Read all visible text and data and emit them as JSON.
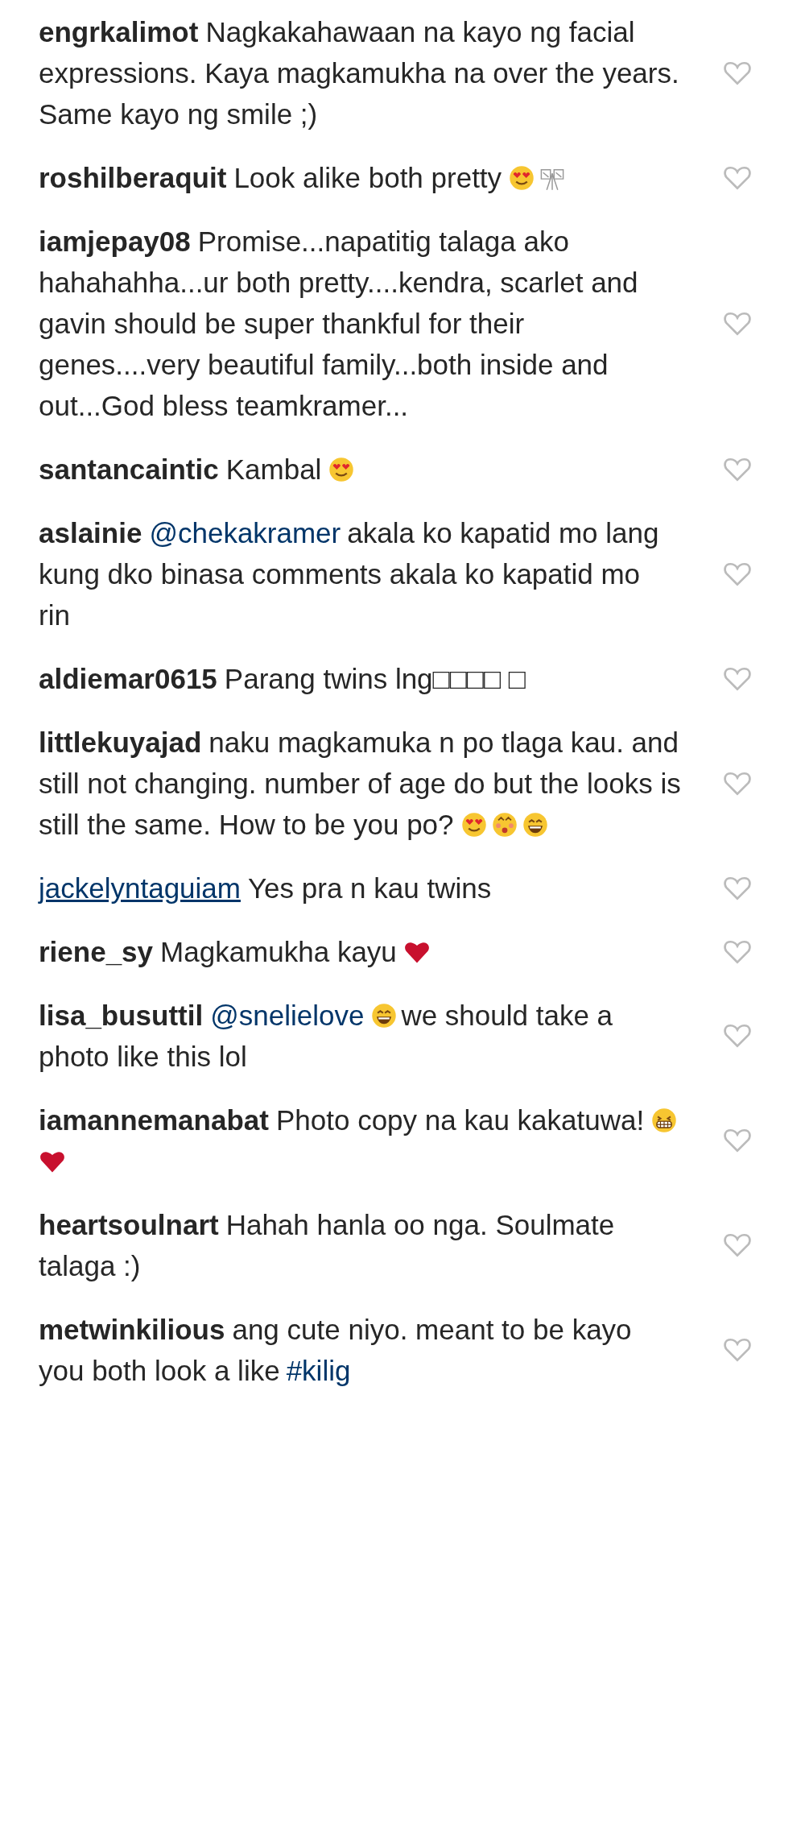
{
  "comments": [
    {
      "username": "engrkalimot",
      "hovered": false,
      "parts": [
        {
          "kind": "text",
          "text": "Nagkakahawaan na kayo ng facial expressions. Kaya magkamukha na over the years. Same kayo ng smile ;)"
        }
      ]
    },
    {
      "username": "roshilberaquit",
      "hovered": false,
      "parts": [
        {
          "kind": "text",
          "text": "Look alike both pretty"
        },
        {
          "kind": "hearteyes"
        },
        {
          "kind": "ribbon"
        }
      ]
    },
    {
      "username": "iamjepay08",
      "hovered": false,
      "parts": [
        {
          "kind": "text",
          "text": "Promise...napatitig talaga ako hahahahha...ur both pretty....kendra, scarlet and gavin should be super thankful for their genes....very beautiful family...both inside and out...God bless teamkramer..."
        }
      ]
    },
    {
      "username": "santancaintic",
      "hovered": false,
      "parts": [
        {
          "kind": "text",
          "text": "Kambal"
        },
        {
          "kind": "hearteyes"
        }
      ]
    },
    {
      "username": "aslainie",
      "hovered": false,
      "parts": [
        {
          "kind": "mention",
          "text": "@chekakramer"
        },
        {
          "kind": "text",
          "text": "akala ko kapatid mo lang kung dko binasa comments akala ko kapatid mo rin"
        }
      ]
    },
    {
      "username": "aldiemar0615",
      "hovered": false,
      "parts": [
        {
          "kind": "text",
          "text": "Parang twins lng□□□□ □"
        }
      ]
    },
    {
      "username": "littlekuyajad",
      "hovered": false,
      "parts": [
        {
          "kind": "text",
          "text": "naku magkamuka n po tlaga kau. and still not changing. number of age do but the looks is still the same. How to be you po?"
        },
        {
          "kind": "hearteyes"
        },
        {
          "kind": "kiss"
        },
        {
          "kind": "laugh"
        }
      ]
    },
    {
      "username": "jackelyntaguiam",
      "hovered": true,
      "parts": [
        {
          "kind": "text",
          "text": "Yes pra n kau twins"
        }
      ]
    },
    {
      "username": "riene_sy",
      "hovered": false,
      "parts": [
        {
          "kind": "text",
          "text": "Magkamukha kayu"
        },
        {
          "kind": "heart"
        }
      ]
    },
    {
      "username": "lisa_busuttil",
      "hovered": false,
      "parts": [
        {
          "kind": "mention",
          "text": "@snelielove"
        },
        {
          "kind": "laugh"
        },
        {
          "kind": "text",
          "text": "we should take a photo like this lol"
        }
      ]
    },
    {
      "username": "iamannemanabat",
      "hovered": false,
      "parts": [
        {
          "kind": "text",
          "text": "Photo copy na kau kakatuwa!"
        },
        {
          "kind": "grin"
        },
        {
          "kind": "heart"
        }
      ]
    },
    {
      "username": "heartsoulnart",
      "hovered": false,
      "parts": [
        {
          "kind": "text",
          "text": "Hahah hanla oo nga. Soulmate talaga :)"
        }
      ]
    },
    {
      "username": "metwinkilious",
      "hovered": false,
      "parts": [
        {
          "kind": "text",
          "text": "ang cute niyo. meant to be kayo you both look a like"
        },
        {
          "kind": "hashtag",
          "text": "#kilig"
        }
      ]
    }
  ]
}
